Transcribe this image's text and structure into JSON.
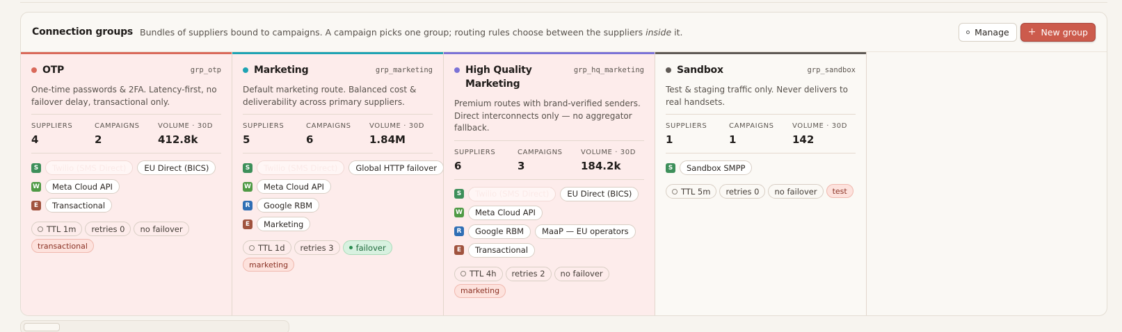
{
  "header": {
    "title": "Connection groups",
    "desc_pre": "Bundles of suppliers bound to campaigns. A campaign picks one group; routing rules choose between the suppliers ",
    "desc_em": "inside",
    "desc_post": " it.",
    "manage_label": "Manage",
    "new_group_label": "New group"
  },
  "stat_labels": {
    "suppliers": "SUPPLIERS",
    "campaigns": "CAMPAIGNS",
    "volume": "VOLUME · 30D"
  },
  "groups": [
    {
      "name": "OTP",
      "id": "grp_otp",
      "color": "#d9695a",
      "tinted": true,
      "description": "One-time passwords & 2FA. Latency-first, no failover delay, transactional only.",
      "suppliers": "4",
      "campaigns": "2",
      "volume": "412.8k",
      "rows": [
        [
          {
            "badge": "S",
            "chips": [
              {
                "label": "Twilio (SMS Direct)",
                "ghost": true
              },
              {
                "label": "EU Direct (BICS)"
              }
            ]
          }
        ],
        [
          {
            "badge": "W",
            "chips": [
              {
                "label": "Meta Cloud API"
              }
            ]
          }
        ],
        [
          {
            "badge": "E",
            "chips": [
              {
                "label": "Transactional"
              }
            ]
          }
        ]
      ],
      "ttl": "TTL  1m",
      "retries": "retries  0",
      "failover": "no failover",
      "failover_on": false,
      "tag": "transactional"
    },
    {
      "name": "Marketing",
      "id": "grp_marketing",
      "color": "#1fa3b3",
      "tinted": true,
      "description": "Default marketing route. Balanced cost & deliverability across primary suppliers.",
      "suppliers": "5",
      "campaigns": "6",
      "volume": "1.84M",
      "rows": [
        [
          {
            "badge": "S",
            "chips": [
              {
                "label": "Twilio (SMS Direct)",
                "ghost": true
              },
              {
                "label": "Global HTTP failover"
              }
            ]
          }
        ],
        [
          {
            "badge": "W",
            "chips": [
              {
                "label": "Meta Cloud API"
              }
            ]
          }
        ],
        [
          {
            "badge": "R",
            "chips": [
              {
                "label": "Google RBM"
              }
            ]
          }
        ],
        [
          {
            "badge": "E",
            "chips": [
              {
                "label": "Marketing"
              }
            ]
          }
        ]
      ],
      "ttl": "TTL  1d",
      "retries": "retries  3",
      "failover": "failover",
      "failover_on": true,
      "tag": "marketing"
    },
    {
      "name": "High Quality Marketing",
      "id": "grp_hq_marketing",
      "color": "#7b72d6",
      "tinted": true,
      "description": "Premium routes with brand-verified senders. Direct interconnects only — no aggregator fallback.",
      "suppliers": "6",
      "campaigns": "3",
      "volume": "184.2k",
      "rows": [
        [
          {
            "badge": "S",
            "chips": [
              {
                "label": "Twilio (SMS Direct)",
                "ghost": true
              },
              {
                "label": "EU Direct (BICS)"
              }
            ]
          }
        ],
        [
          {
            "badge": "W",
            "chips": [
              {
                "label": "Meta Cloud API"
              }
            ]
          }
        ],
        [
          {
            "badge": "R",
            "chips": [
              {
                "label": "Google RBM"
              },
              {
                "label": "MaaP — EU operators"
              }
            ]
          }
        ],
        [
          {
            "badge": "E",
            "chips": [
              {
                "label": "Transactional"
              }
            ]
          }
        ]
      ],
      "ttl": "TTL  4h",
      "retries": "retries  2",
      "failover": "no failover",
      "failover_on": false,
      "tag": "marketing"
    },
    {
      "name": "Sandbox",
      "id": "grp_sandbox",
      "color": "#5f5a55",
      "tinted": false,
      "description": "Test & staging traffic only. Never delivers to real handsets.",
      "suppliers": "1",
      "campaigns": "1",
      "volume": "142",
      "rows": [
        [
          {
            "badge": "S",
            "chips": [
              {
                "label": "Sandbox SMPP"
              }
            ]
          }
        ]
      ],
      "ttl": "TTL  5m",
      "retries": "retries  0",
      "failover": "no failover",
      "failover_on": false,
      "tag": "test"
    }
  ]
}
